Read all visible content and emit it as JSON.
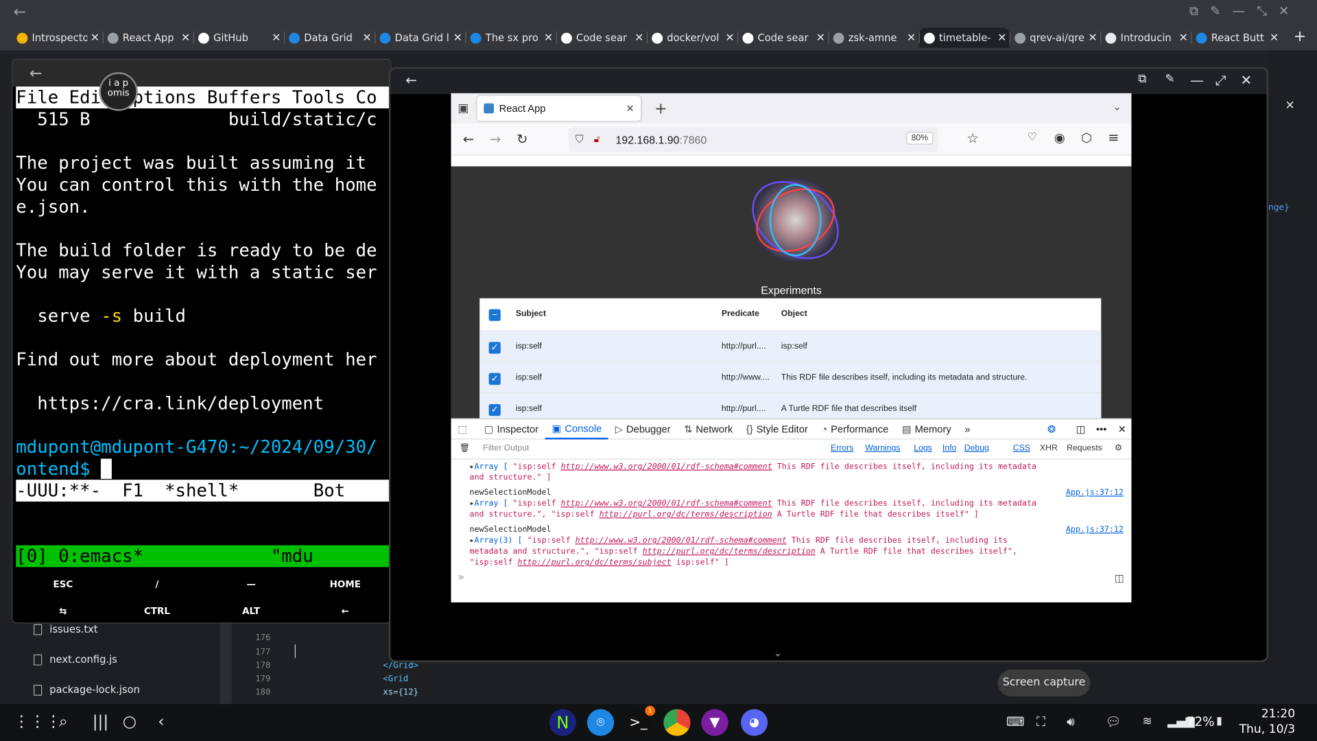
{
  "browser_tabs": [
    {
      "label": "Introspecto",
      "icon_color": "#f4b400"
    },
    {
      "label": "React App",
      "icon_color": "#9aa0a6"
    },
    {
      "label": "GitHub",
      "icon_color": "#ffffff"
    },
    {
      "label": "Data Grid",
      "icon_color": "#1e88e5"
    },
    {
      "label": "Data Grid l",
      "icon_color": "#1e88e5"
    },
    {
      "label": "The sx pro",
      "icon_color": "#1e88e5"
    },
    {
      "label": "Code sear",
      "icon_color": "#ffffff"
    },
    {
      "label": "docker/vol",
      "icon_color": "#ffffff"
    },
    {
      "label": "Code sear",
      "icon_color": "#ffffff"
    },
    {
      "label": "zsk-amne",
      "icon_color": "#9aa0a6"
    },
    {
      "label": "timetable-",
      "icon_color": "#ffffff"
    },
    {
      "label": "qrev-ai/qre",
      "icon_color": "#9aa0a6"
    },
    {
      "label": "Introducin",
      "icon_color": "#e8eaed"
    },
    {
      "label": "React Butt",
      "icon_color": "#1e88e5"
    }
  ],
  "terminal": {
    "menu": "File Edit Options Buffers Tools Co",
    "lines": [
      "  515 B             build/static/c",
      "",
      "The project was built assuming it ",
      "You can control this with the home",
      "e.json.",
      "",
      "The build folder is ready to be de",
      "You may serve it with a static ser",
      ""
    ],
    "serve_cmd": "  serve ",
    "serve_flag": "-s",
    "serve_arg": " build",
    "lines2": [
      "",
      "Find out more about deployment her",
      "",
      "  https://cra.link/deployment",
      ""
    ],
    "prompt1": "mdupont@mdupont-G470:~/2024/09/30/",
    "prompt2": "ontend$ ",
    "modeline": "-UUU:**-  F1  *shell*       Bot",
    "tmux": "[0] 0:emacs*            \"mdu",
    "keys": [
      "ESC",
      "/",
      "—",
      "HOME",
      "⇆",
      "CTRL",
      "ALT",
      "←"
    ],
    "avatar": "i a p\nomis"
  },
  "firefox": {
    "tab_title": "React App",
    "url_host": "192.168.1.90",
    "url_port": ":7860",
    "zoom": "80%",
    "heading": "Experiments",
    "columns": [
      "Subject",
      "Predicate",
      "Object"
    ],
    "rows": [
      {
        "subject": "isp:self",
        "predicate": "http://purl....",
        "object": "isp:self"
      },
      {
        "subject": "isp:self",
        "predicate": "http://www....",
        "object": "This RDF file describes itself, including its metadata and structure."
      },
      {
        "subject": "isp:self",
        "predicate": "http://purl....",
        "object": "A Turtle RDF file that describes itself"
      }
    ]
  },
  "devtools": {
    "tabs": [
      "Inspector",
      "Console",
      "Debugger",
      "Network",
      "Style Editor",
      "Performance",
      "Memory"
    ],
    "filter_placeholder": "Filter Output",
    "filters": [
      "Errors",
      "Warnings",
      "Logs",
      "Info",
      "Debug",
      "CSS",
      "XHR",
      "Requests"
    ],
    "log0": {
      "a": "Array [ ",
      "b": "\"isp:self ",
      "c": "http://www.w3.org/2000/01/rdf-schema#comment",
      "d": " This RDF file describes itself, including its metadata",
      "e": "and structure.\" ]"
    },
    "log1": {
      "title": "newSelectionModel",
      "src": "App.js:37:12",
      "a": "Array [ ",
      "b": "\"isp:self ",
      "c": "http://www.w3.org/2000/01/rdf-schema#comment",
      "d": " This RDF file describes itself, including its metadata",
      "e": "and structure.\", \"isp:self ",
      "f": "http://purl.org/dc/terms/description",
      "g": " A Turtle RDF file that describes itself\" ]"
    },
    "log2": {
      "title": "newSelectionModel",
      "src": "App.js:37:12",
      "a": "Array(3) [ ",
      "b": "\"isp:self ",
      "c": "http://www.w3.org/2000/01/rdf-schema#comment",
      "d": " This RDF file describes itself, including its",
      "e": "metadata and structure.\", \"isp:self ",
      "f": "http://purl.org/dc/terms/description",
      "g": " A Turtle RDF file that describes itself\",",
      "h": "\"isp:self ",
      "i": "http://purl.org/dc/terms/subject",
      "j": " isp:self\" ]"
    }
  },
  "bg": {
    "files": [
      "issues.txt",
      "next.config.js",
      "package-lock.json"
    ],
    "line_numbers": [
      "176",
      "177",
      "178",
      "179",
      "180"
    ],
    "code": [
      "",
      "",
      "</Grid>",
      "<Grid",
      "  xs={12}"
    ],
    "side_text": "nge}"
  },
  "screen_capture": "Screen capture",
  "status": {
    "battery": "72%",
    "time": "21:20",
    "date": "Thu, 10/3",
    "badge": "1"
  }
}
